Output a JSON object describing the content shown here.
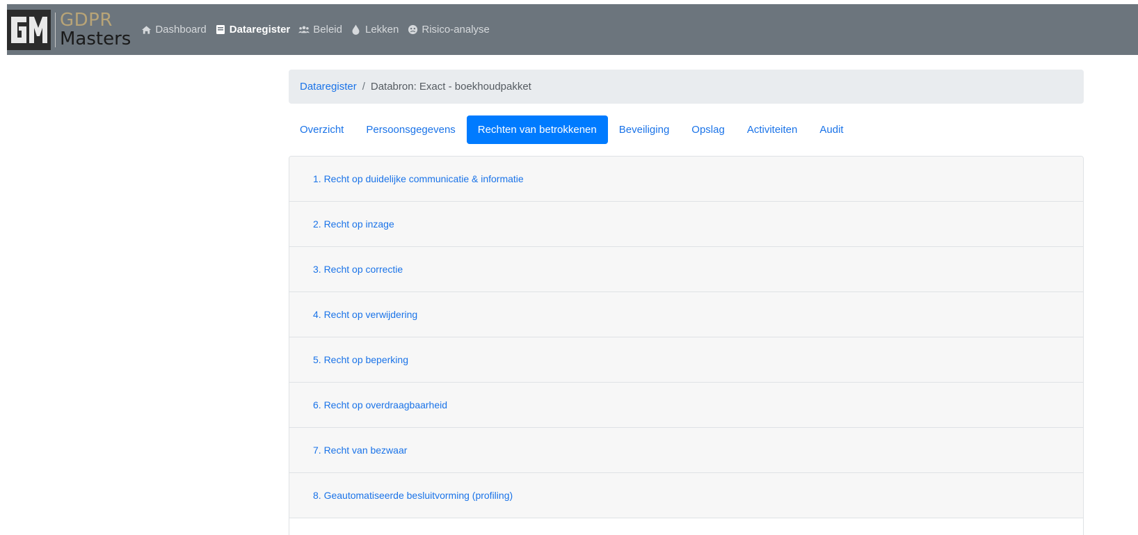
{
  "brand": {
    "line1": "GDPR",
    "line2": "Masters",
    "colors": {
      "gold": "#b8a477",
      "dark": "#1a1a1a"
    }
  },
  "nav": {
    "items": [
      {
        "label": "Dashboard",
        "icon": "home-icon",
        "active": false
      },
      {
        "label": "Dataregister",
        "icon": "book-icon",
        "active": true
      },
      {
        "label": "Beleid",
        "icon": "users-icon",
        "active": false
      },
      {
        "label": "Lekken",
        "icon": "droplet-icon",
        "active": false
      },
      {
        "label": "Risico-analyse",
        "icon": "biohazard-icon",
        "active": false
      }
    ]
  },
  "breadcrumb": {
    "parent": "Dataregister",
    "separator": "/",
    "current": "Databron: Exact - boekhoudpakket"
  },
  "tabs": [
    {
      "label": "Overzicht",
      "active": false
    },
    {
      "label": "Persoonsgegevens",
      "active": false
    },
    {
      "label": "Rechten van betrokkenen",
      "active": true
    },
    {
      "label": "Beveiliging",
      "active": false
    },
    {
      "label": "Opslag",
      "active": false
    },
    {
      "label": "Activiteiten",
      "active": false
    },
    {
      "label": "Audit",
      "active": false
    }
  ],
  "rights": [
    {
      "label": "1. Recht op duidelijke communicatie & informatie"
    },
    {
      "label": "2. Recht op inzage"
    },
    {
      "label": "3. Recht op correctie"
    },
    {
      "label": "4. Recht op verwijdering"
    },
    {
      "label": "5. Recht op beperking"
    },
    {
      "label": "6. Recht op overdraagbaarheid"
    },
    {
      "label": "7. Recht van bezwaar"
    },
    {
      "label": "8. Geautomatiseerde besluitvorming (profiling)"
    }
  ],
  "colors": {
    "navbar": "#6c757d",
    "link": "#1a73e8",
    "active_tab": "#007bff",
    "breadcrumb_bg": "#e9ecef",
    "list_bg": "#f7f7f7"
  }
}
